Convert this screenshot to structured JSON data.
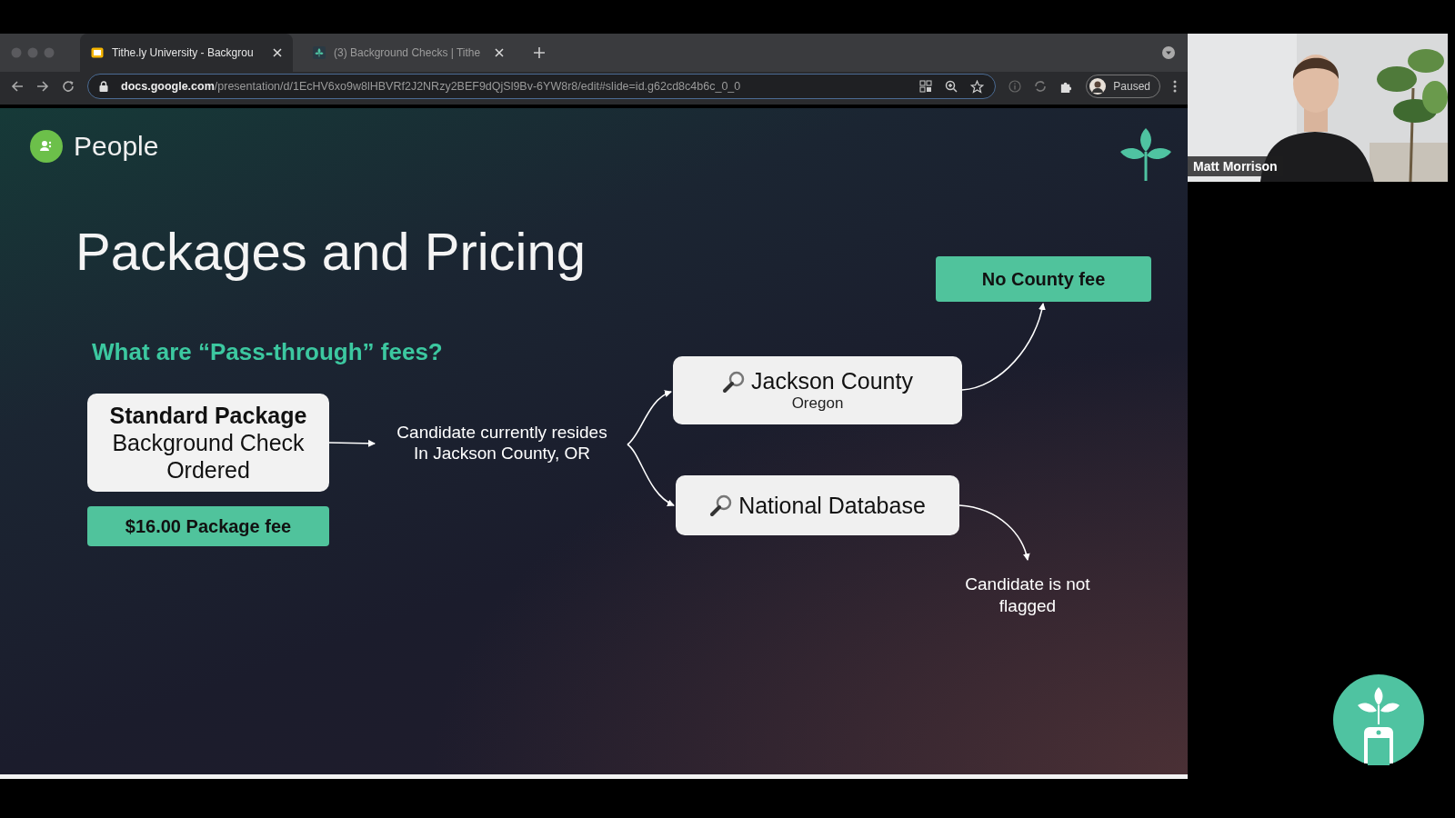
{
  "browser": {
    "tabs": [
      {
        "title": "Tithe.ly University - Backgrou",
        "kind": "slides",
        "selected": true
      },
      {
        "title": "(3) Background Checks | Tithe",
        "kind": "tithely",
        "selected": false
      }
    ],
    "address": {
      "domain": "docs.google.com",
      "path": "/presentation/d/1EcHV6xo9w8lHBVRf2J2NRzy2BEF9dQjSl9Bv-6YW8r8/edit#slide=id.g62cd8c4b6c_0_0"
    },
    "profile_status": "Paused"
  },
  "slide": {
    "section": "People",
    "title": "Packages and Pricing",
    "subtitle": "What are “Pass-through” fees?",
    "package": {
      "title": "Standard Package",
      "detail": "Background Check Ordered"
    },
    "package_fee": "$16.00 Package fee",
    "condition": [
      "Candidate currently resides",
      "In Jackson County, OR"
    ],
    "searches": [
      {
        "title": "Jackson County",
        "subtitle": "Oregon"
      },
      {
        "title": "National Database"
      }
    ],
    "county_fee": "No County fee",
    "result": [
      "Candidate is not",
      "flagged"
    ]
  },
  "webcam": {
    "name": "Matt Morrison"
  }
}
